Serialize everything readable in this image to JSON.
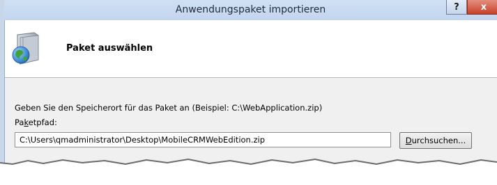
{
  "window": {
    "title": "Anwendungspaket importieren",
    "help_label": "?",
    "close_label": "x"
  },
  "header": {
    "title": "Paket auswählen",
    "icon": "package-globe-icon"
  },
  "form": {
    "description": "Geben Sie den Speicherort für das Paket an (Beispiel: C:\\WebApplication.zip)",
    "path_label_pre": "Pa",
    "path_label_mnemonic": "k",
    "path_label_post": "etpfad:",
    "path_value": "C:\\Users\\qmadministrator\\Desktop\\MobileCRMWebEdition.zip",
    "browse_mnemonic": "D",
    "browse_post": "urchsuchen..."
  },
  "colors": {
    "titlebar": "#c3d6ef",
    "close_button": "#c7412a",
    "dialog_bg": "#f0f0f0"
  }
}
